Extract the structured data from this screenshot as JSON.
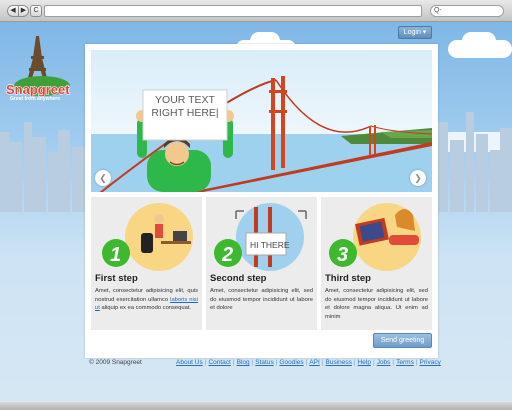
{
  "browser": {
    "back_glyph": "◀",
    "forward_glyph": "▶",
    "reload_glyph": "C",
    "search_glyph": "Q-"
  },
  "header": {
    "logo_text": "Snapgreet",
    "logo_tagline": "Greet from anywhere",
    "login_label": "Login ▾"
  },
  "hero": {
    "sign_text": "YOUR TEXT RIGHT HERE|",
    "prev_glyph": "❮",
    "next_glyph": "❯"
  },
  "steps": [
    {
      "number": "1",
      "title": "First step",
      "text_before": "Amet, consectetur adipisicing elit, quis nostrud exercitation ullamco ",
      "link": "laboris nisi ut",
      "text_after": " aliquip ex ea commodo consequat."
    },
    {
      "number": "2",
      "title": "Second step",
      "sign": "HI THERE",
      "text": "Amet, consectetur adipisicing elit, sed do eiusmod tempor incididunt ut labore et dolore"
    },
    {
      "number": "3",
      "title": "Third step",
      "text": "Amet, consectetur adipisicing elit, sed do eiusmod tempor incididunt ut labore et dolore magna aliqua. Ut enim ad minim"
    }
  ],
  "send_label": "Send greeting",
  "footer": {
    "copyright": "© 2009 Snapgreet",
    "links": [
      "About Us",
      "Contact",
      "Blog",
      "Status",
      "Goodies",
      "API",
      "Business",
      "Help",
      "Jobs",
      "Terms",
      "Privacy"
    ]
  },
  "colors": {
    "accent": "#6f9ccb",
    "step_number_green": "#3db82f",
    "link": "#2a6cb5"
  }
}
